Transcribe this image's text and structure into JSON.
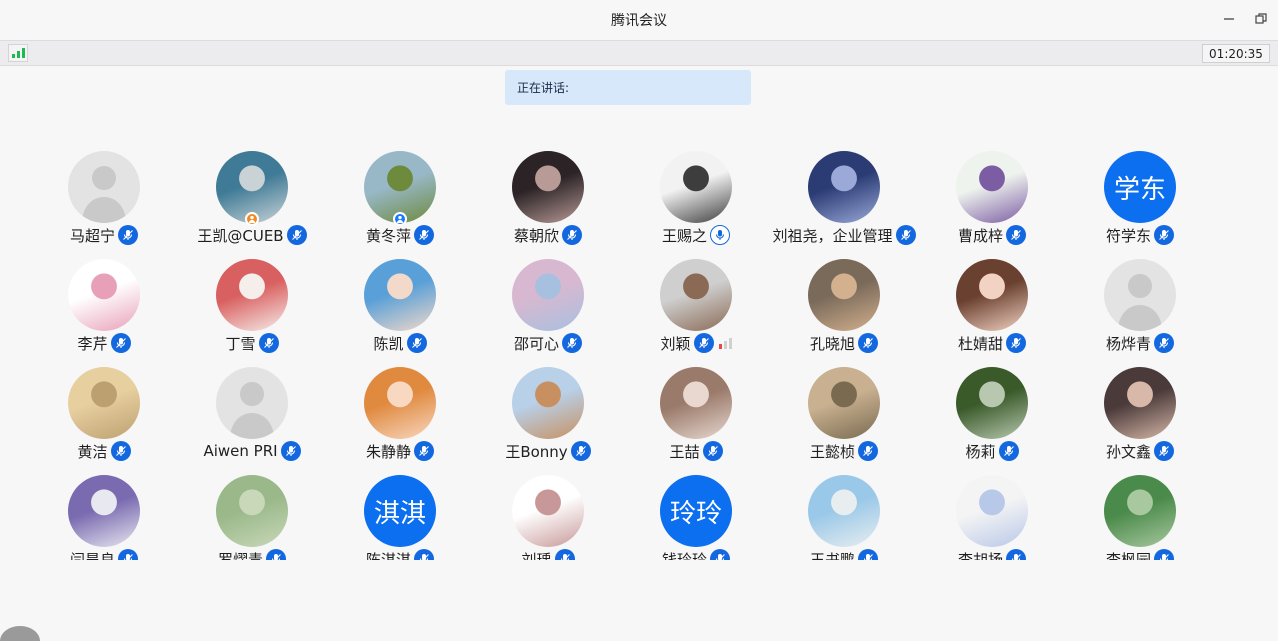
{
  "window": {
    "title": "腾讯会议"
  },
  "toolbar": {
    "timer": "01:20:35"
  },
  "speaking": {
    "label": "正在讲话:"
  },
  "participants": [
    {
      "name": "马超宁",
      "avatar": "default"
    },
    {
      "name": "王凯@CUEB",
      "avatar": "photo",
      "c1": "#3f7a96",
      "c2": "#c9d3d6",
      "badge": "orange"
    },
    {
      "name": "黄冬萍",
      "avatar": "photo",
      "c1": "#98b8c8",
      "c2": "#6e8a3c",
      "badge": "blue"
    },
    {
      "name": "蔡朝欣",
      "avatar": "photo",
      "c1": "#2b2326",
      "c2": "#b89a96"
    },
    {
      "name": "王赐之",
      "avatar": "photo",
      "c1": "#f2f2f2",
      "c2": "#3d3d3d",
      "mic_off": true
    },
    {
      "name": "刘祖尧，企业管理",
      "avatar": "photo",
      "c1": "#2b3c75",
      "c2": "#9aa9d8"
    },
    {
      "name": "曹成梓",
      "avatar": "photo",
      "c1": "#eef3ee",
      "c2": "#7c5ca3"
    },
    {
      "name": "符学东",
      "avatar": "text",
      "text": "学东"
    },
    {
      "name": "李芹",
      "avatar": "photo",
      "c1": "#ffffff",
      "c2": "#e8a0b8"
    },
    {
      "name": "丁雪",
      "avatar": "photo",
      "c1": "#d96060",
      "c2": "#f5eeea"
    },
    {
      "name": "陈凯",
      "avatar": "photo",
      "c1": "#5aa0d8",
      "c2": "#f2d9c9"
    },
    {
      "name": "邵可心",
      "avatar": "photo",
      "c1": "#d8b8d0",
      "c2": "#a8c0e0"
    },
    {
      "name": "刘颖",
      "avatar": "photo",
      "c1": "#cfcfcf",
      "c2": "#8a6a55",
      "vol": 1
    },
    {
      "name": "孔晓旭",
      "avatar": "photo",
      "c1": "#7a6a5a",
      "c2": "#d3b08e"
    },
    {
      "name": "杜婧甜",
      "avatar": "photo",
      "c1": "#6a4030",
      "c2": "#f2d2c2"
    },
    {
      "name": "杨烨青",
      "avatar": "default"
    },
    {
      "name": "黄洁",
      "avatar": "photo",
      "c1": "#e8cfa0",
      "c2": "#bca070"
    },
    {
      "name": "Aiwen PRI",
      "avatar": "default"
    },
    {
      "name": "朱静静",
      "avatar": "photo",
      "c1": "#e08a40",
      "c2": "#f8d8c0"
    },
    {
      "name": "王Bonny",
      "avatar": "photo",
      "c1": "#b8d0e8",
      "c2": "#c89060"
    },
    {
      "name": "王喆",
      "avatar": "photo",
      "c1": "#9a7a6a",
      "c2": "#e8d8d0"
    },
    {
      "name": "王懿桢",
      "avatar": "photo",
      "c1": "#c8b090",
      "c2": "#7a6a50"
    },
    {
      "name": "杨莉",
      "avatar": "photo",
      "c1": "#3a5a2a",
      "c2": "#b8c8b0"
    },
    {
      "name": "孙文鑫",
      "avatar": "photo",
      "c1": "#4a3a3a",
      "c2": "#d8b8a8"
    },
    {
      "name": "闫昊良",
      "avatar": "photo",
      "c1": "#7a6ab0",
      "c2": "#e8e8f0"
    },
    {
      "name": "罗熠青",
      "avatar": "photo",
      "c1": "#9ab88a",
      "c2": "#c8d8b8"
    },
    {
      "name": "陈淇淇",
      "avatar": "text",
      "text": "淇淇"
    },
    {
      "name": "刘瑀",
      "avatar": "photo",
      "c1": "#ffffff",
      "c2": "#c89898"
    },
    {
      "name": "钱玲玲",
      "avatar": "text",
      "text": "玲玲"
    },
    {
      "name": "王书鹏",
      "avatar": "photo",
      "c1": "#9ac8e8",
      "c2": "#e8eef0"
    },
    {
      "name": "李胡扬",
      "avatar": "photo",
      "c1": "#f4f4f4",
      "c2": "#b8c8e8"
    },
    {
      "name": "李枫园",
      "avatar": "photo",
      "c1": "#4a8a4a",
      "c2": "#a8c8a0"
    }
  ]
}
